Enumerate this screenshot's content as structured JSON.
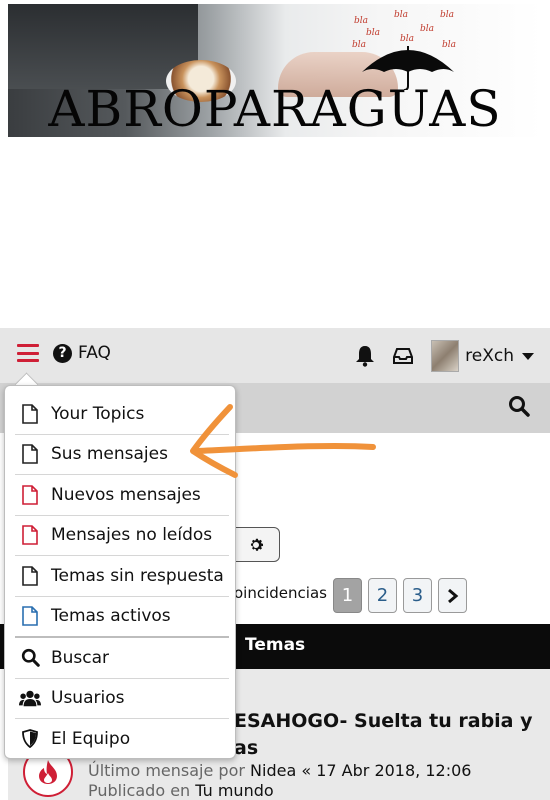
{
  "banner": {
    "title": "ABROPARAGUAS",
    "bubble_text": [
      "bla",
      "bla",
      "bla",
      "bla",
      "bla",
      "bla",
      "bla",
      "bla"
    ]
  },
  "navbar": {
    "faq_label": "FAQ",
    "username": "reXch"
  },
  "dropdown": {
    "items": [
      {
        "label": "Your Topics",
        "icon": "document-icon",
        "icon_color": "#222222"
      },
      {
        "label": "Sus mensajes",
        "icon": "document-icon",
        "icon_color": "#222222"
      },
      {
        "label": "Nuevos mensajes",
        "icon": "document-icon",
        "icon_color": "#cf1f36"
      },
      {
        "label": "Mensajes no leídos",
        "icon": "document-icon",
        "icon_color": "#cf1f36"
      },
      {
        "label": "Temas sin respuesta",
        "icon": "document-icon",
        "icon_color": "#222222"
      },
      {
        "label": "Temas activos",
        "icon": "document-icon",
        "icon_color": "#2a6fb0"
      },
      {
        "label": "Buscar",
        "icon": "search-icon"
      },
      {
        "label": "Usuarios",
        "icon": "users-icon"
      },
      {
        "label": "El Equipo",
        "icon": "shield-icon"
      }
    ]
  },
  "search": {
    "matches_text": "oincidencias",
    "pages": [
      "1",
      "2",
      "3"
    ],
    "current_page": "1"
  },
  "topics": {
    "header": "Temas",
    "title_line1": "ESAHOGO- Suelta tu rabia y",
    "title_line2": "as",
    "last_post_prefix": "Último mensaje por",
    "last_post_author": "Nidea",
    "last_post_date": "« 17 Abr 2018, 12:06",
    "published_prefix": "Publicado en",
    "published_forum": "Tu mundo"
  },
  "colors": {
    "accent": "#cf1f36",
    "link": "#2a5d8a",
    "annotation_arrow": "#f0923a"
  }
}
